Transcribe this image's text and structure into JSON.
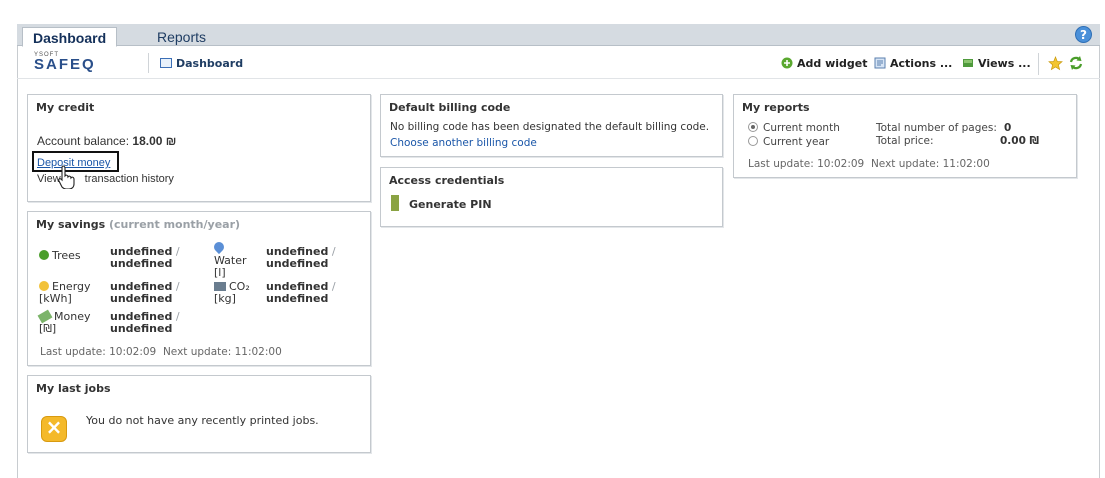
{
  "tabs": {
    "dashboard": "Dashboard",
    "reports": "Reports"
  },
  "help": {
    "glyph": "?"
  },
  "brand": {
    "top": "YSOFT",
    "name": "SAFEQ"
  },
  "breadcrumb": {
    "label": "Dashboard"
  },
  "toolbar": {
    "add_widget": "Add widget",
    "actions": "Actions ...",
    "views": "Views ..."
  },
  "my_credit": {
    "title": "My credit",
    "balance_label": "Account balance:",
    "balance_value": "18.00 ₪",
    "deposit_link": "Deposit money",
    "history_link": "View transaction history",
    "history_prefix": "View",
    "history_suffix": "transaction history"
  },
  "my_savings": {
    "title": "My savings",
    "subtitle": "(current month/year)",
    "rows": [
      {
        "label": "Trees",
        "value1": "undefined",
        "slash": "/",
        "value2": "undefined"
      },
      {
        "label": "Energy [kWh]",
        "value1": "undefined",
        "slash": "/",
        "value2": "undefined"
      },
      {
        "label": "Money [₪]",
        "value1": "undefined",
        "slash": "/",
        "value2": "undefined"
      },
      {
        "label": "Water [l]",
        "value1": "undefined",
        "slash": "/",
        "value2": "undefined"
      },
      {
        "label": "CO₂ [kg]",
        "value1": "undefined",
        "slash": "/",
        "value2": "undefined"
      }
    ],
    "last_update": "Last update: 10:02:09",
    "next_update": "Next update: 11:02:00"
  },
  "last_jobs": {
    "title": "My last jobs",
    "message": "You do not have any recently printed jobs."
  },
  "billing": {
    "title": "Default billing code",
    "message": "No billing code has been designated the default billing code.",
    "link": "Choose another billing code"
  },
  "access": {
    "title": "Access credentials",
    "generate": "Generate PIN"
  },
  "reports": {
    "title": "My reports",
    "option_month": "Current month",
    "option_year": "Current year",
    "pages_label": "Total number of pages:",
    "pages_value": "0",
    "price_label": "Total price:",
    "price_value": "0.00 ₪",
    "last_update": "Last update: 10:02:09",
    "next_update": "Next update: 11:02:00"
  }
}
